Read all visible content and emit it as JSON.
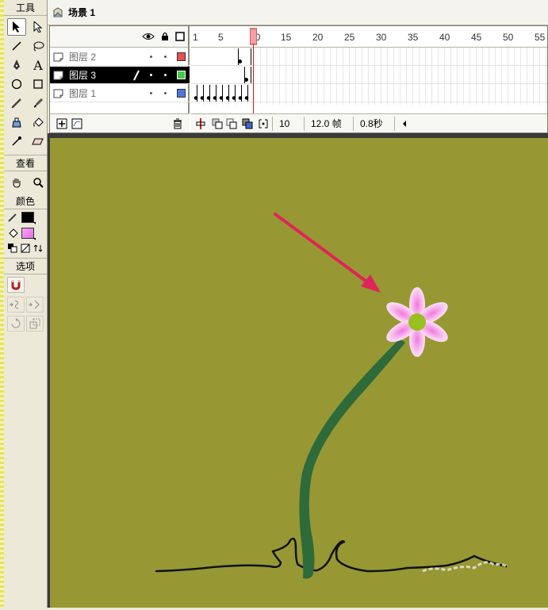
{
  "tools_panel": {
    "title": "工具",
    "tools": [
      {
        "name": "arrow-tool"
      },
      {
        "name": "subselect-tool"
      },
      {
        "name": "line-tool"
      },
      {
        "name": "lasso-tool"
      },
      {
        "name": "pen-tool"
      },
      {
        "name": "text-tool"
      },
      {
        "name": "oval-tool"
      },
      {
        "name": "rectangle-tool"
      },
      {
        "name": "pencil-tool"
      },
      {
        "name": "brush-tool"
      },
      {
        "name": "ink-bottle-tool"
      },
      {
        "name": "paint-bucket-tool"
      },
      {
        "name": "eyedropper-tool"
      },
      {
        "name": "eraser-tool"
      }
    ],
    "view_title": "查看",
    "color_title": "颜色",
    "stroke_color": "#000000",
    "fill_color": "#ee88ee",
    "options_title": "选项"
  },
  "scene": {
    "label": "场景 1"
  },
  "timeline": {
    "ruler_numbers": [
      "1",
      "5",
      "10",
      "15",
      "20",
      "25",
      "30",
      "35",
      "40",
      "45",
      "50",
      "55"
    ],
    "current_frame": "10",
    "frame_rate": "12.0 帧",
    "elapsed_time": "0.8秒",
    "layers": [
      {
        "name": "图层 2",
        "color": "#e85050",
        "selected": false
      },
      {
        "name": "图层 3",
        "color": "#44cc44",
        "selected": true
      },
      {
        "name": "图层 1",
        "color": "#4a78e0",
        "selected": false
      }
    ]
  },
  "stage": {
    "background": "#979834",
    "flower_petal_color": "#f7b8ee",
    "flower_center_color": "#99c020",
    "stem_color": "#2e6a3a",
    "arrow_color": "#e0245a"
  }
}
